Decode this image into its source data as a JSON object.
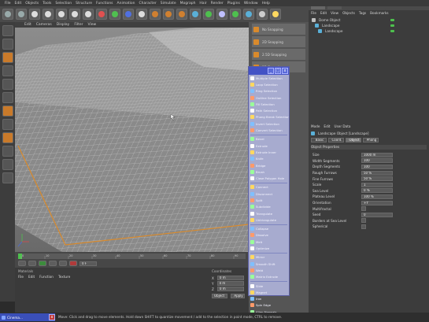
{
  "menubar": [
    "File",
    "Edit",
    "Objects",
    "Tools",
    "Selection",
    "Structure",
    "Functions",
    "Animation",
    "Character",
    "Simulate",
    "Mograph",
    "Hair",
    "Render",
    "Plugins",
    "Window",
    "Help"
  ],
  "toolbar_icons": [
    "undo-icon",
    "redo-icon",
    "live-selection-icon",
    "move-icon",
    "scale-icon",
    "rotate-icon",
    "recent-icon",
    "x-axis-icon",
    "y-axis-icon",
    "z-axis-icon",
    "world-icon",
    "render-view-icon",
    "render-icon",
    "render-settings-icon",
    "cube-icon",
    "pen-icon",
    "subdivision-icon",
    "array-icon",
    "environment-icon",
    "camera-icon",
    "light-icon"
  ],
  "viewport": {
    "menu": [
      "Edit",
      "Cameras",
      "Display",
      "Filter",
      "View"
    ]
  },
  "midcol": {
    "buttons": [
      "No Snapping",
      "2D Snapping",
      "2.5D Snapping",
      "3D Snapping"
    ]
  },
  "palette": {
    "title_buttons": [
      "_",
      "□",
      "x"
    ],
    "groups": [
      [
        "Multiple Selection",
        "Loop Selection",
        "Ring Selection",
        "Outline Selection",
        "Fill Selection",
        "Path Selection",
        "Phong Break Selection",
        "Invert Selection",
        "Convert Selection"
      ],
      [
        "Bevel",
        "Extrude",
        "Extrude Inner",
        "Knife",
        "Bridge",
        "Brush",
        "Close Polygon Hole"
      ],
      [
        "Connect",
        "Disconnect",
        "Split",
        "Subdivide",
        "Triangulate",
        "Untriangulate"
      ],
      [
        "Collapse",
        "Dissolve",
        "Melt",
        "Optimize"
      ],
      [
        "Mirror",
        "Smooth Shift",
        "Weld",
        "Matrix Extrude"
      ],
      [
        "Slide",
        "Magnet",
        "Iron",
        "Spin Edge",
        "Align Normals",
        "Reverse Normals"
      ]
    ]
  },
  "objmgr": {
    "menu": [
      "File",
      "Edit",
      "View",
      "Objects",
      "Tags",
      "Bookmarks"
    ],
    "objects": [
      "Dome Object",
      "Landscape",
      "Landscape"
    ]
  },
  "attrmgr": {
    "menu": [
      "Mode",
      "Edit",
      "User Data"
    ],
    "object_title": "Landscape Object [Landscape]",
    "tabs": [
      "Basic",
      "Coord.",
      "Object",
      "Phong"
    ],
    "section": "Object Properties",
    "fields": [
      {
        "label": "Size",
        "value": "1000 m"
      },
      {
        "label": "Width Segments",
        "value": "100"
      },
      {
        "label": "Depth Segments",
        "value": "100"
      },
      {
        "label": "Rough Furrows",
        "value": "50 %"
      },
      {
        "label": "Fine Furrows",
        "value": "50 %"
      },
      {
        "label": "Scale",
        "value": "1"
      },
      {
        "label": "Sea Level",
        "value": "0 %"
      },
      {
        "label": "Plateau Level",
        "value": "100 %"
      },
      {
        "label": "Orientation",
        "value": "+Y"
      },
      {
        "label": "Multifractal",
        "value": ""
      },
      {
        "label": "Seed",
        "value": "0"
      },
      {
        "label": "Borders at Sea Level",
        "value": ""
      },
      {
        "label": "Spherical",
        "value": ""
      }
    ]
  },
  "timeline": {
    "ticks": [
      "0",
      "10",
      "20",
      "30",
      "40",
      "50",
      "60",
      "70",
      "80",
      "90"
    ],
    "frame": "0 F"
  },
  "materials": {
    "title": "Materials",
    "menu": [
      "File",
      "Edit",
      "Function",
      "Texture"
    ]
  },
  "coords": {
    "title": "Coordinates",
    "rows": [
      {
        "label": "X",
        "value": "0 m"
      },
      {
        "label": "Y",
        "value": "0 m"
      },
      {
        "label": "Z",
        "value": "0 m"
      }
    ],
    "mode": "Object",
    "apply": "Apply"
  },
  "status": {
    "text": "Move: Click and drag to move elements. Hold down SHIFT to quantize movement / add to the selection in point mode, CTRL to remove.",
    "taskbar_label": "Cinema..."
  },
  "colors": {
    "palette_title": "#4352c5",
    "palette_body": "#a7abcf",
    "accent_orange": "#d98a2c"
  }
}
